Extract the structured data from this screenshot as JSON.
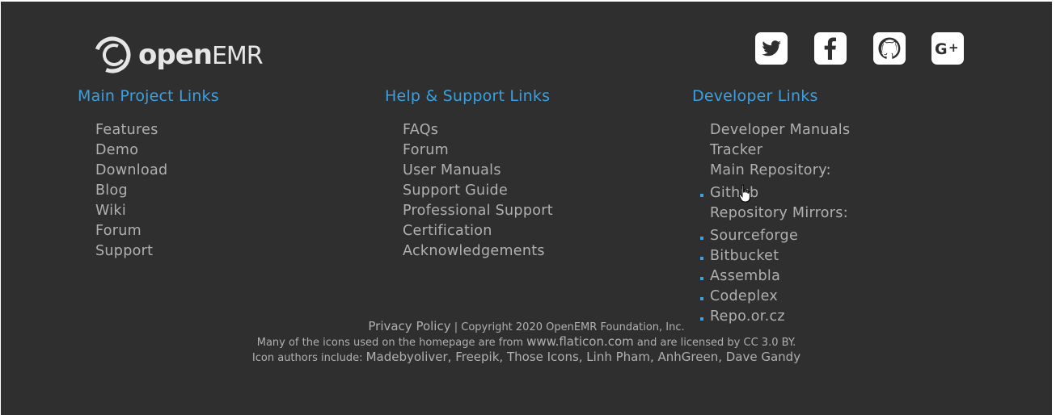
{
  "logo": {
    "open": "open",
    "emr": "EMR"
  },
  "social": {
    "twitter": "twitter-icon",
    "facebook": "facebook-icon",
    "github": "github-icon",
    "googleplus": "google-plus-icon"
  },
  "columns": {
    "main": {
      "heading": "Main Project Links",
      "links": [
        "Features",
        "Demo",
        "Download",
        "Blog",
        "Wiki",
        "Forum",
        "Support"
      ]
    },
    "help": {
      "heading": "Help & Support Links",
      "links": [
        "FAQs",
        "Forum",
        "User Manuals",
        "Support Guide",
        "Professional Support",
        "Certification",
        "Acknowledgements"
      ]
    },
    "dev": {
      "heading": "Developer Links",
      "links": [
        "Developer Manuals",
        "Tracker"
      ],
      "main_repo_label": "Main Repository:",
      "main_repo": [
        "Github"
      ],
      "mirrors_label": "Repository Mirrors:",
      "mirrors": [
        "Sourceforge",
        "Bitbucket",
        "Assembla",
        "Codeplex",
        "Repo.or.cz"
      ]
    }
  },
  "footer": {
    "privacy": "Privacy Policy",
    "copyright": " | Copyright 2020 OpenEMR Foundation, Inc.",
    "icons_prefix": "Many of the icons used on the homepage are from ",
    "flaticon": "www.flaticon.com",
    "icons_mid": " and are licensed by ",
    "license": "CC 3.0 BY",
    "icons_suffix": ".",
    "authors_prefix": "Icon authors include: ",
    "authors": "Madebyoliver, Freepik, Those Icons, Linh Pham, AnhGreen, Dave Gandy"
  },
  "colors": {
    "background": "#2f2f2f",
    "heading": "#3aa0e0",
    "link": "#b0b0b0"
  }
}
